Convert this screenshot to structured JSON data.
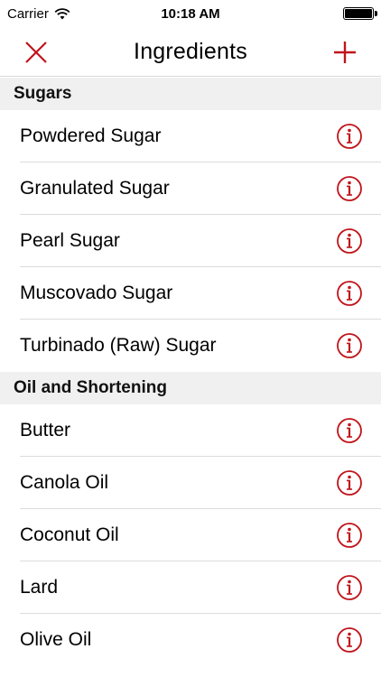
{
  "status": {
    "carrier": "Carrier",
    "time": "10:18 AM",
    "battery_level": 1.0
  },
  "nav": {
    "title": "Ingredients",
    "close_icon": "close-icon",
    "add_icon": "plus-icon",
    "accent": "#c0141b"
  },
  "sections": [
    {
      "title": "Sugars",
      "items": [
        "Powdered Sugar",
        "Granulated Sugar",
        "Pearl Sugar",
        "Muscovado Sugar",
        "Turbinado (Raw) Sugar"
      ]
    },
    {
      "title": "Oil and Shortening",
      "items": [
        "Butter",
        "Canola Oil",
        "Coconut Oil",
        "Lard",
        "Olive Oil"
      ]
    }
  ]
}
